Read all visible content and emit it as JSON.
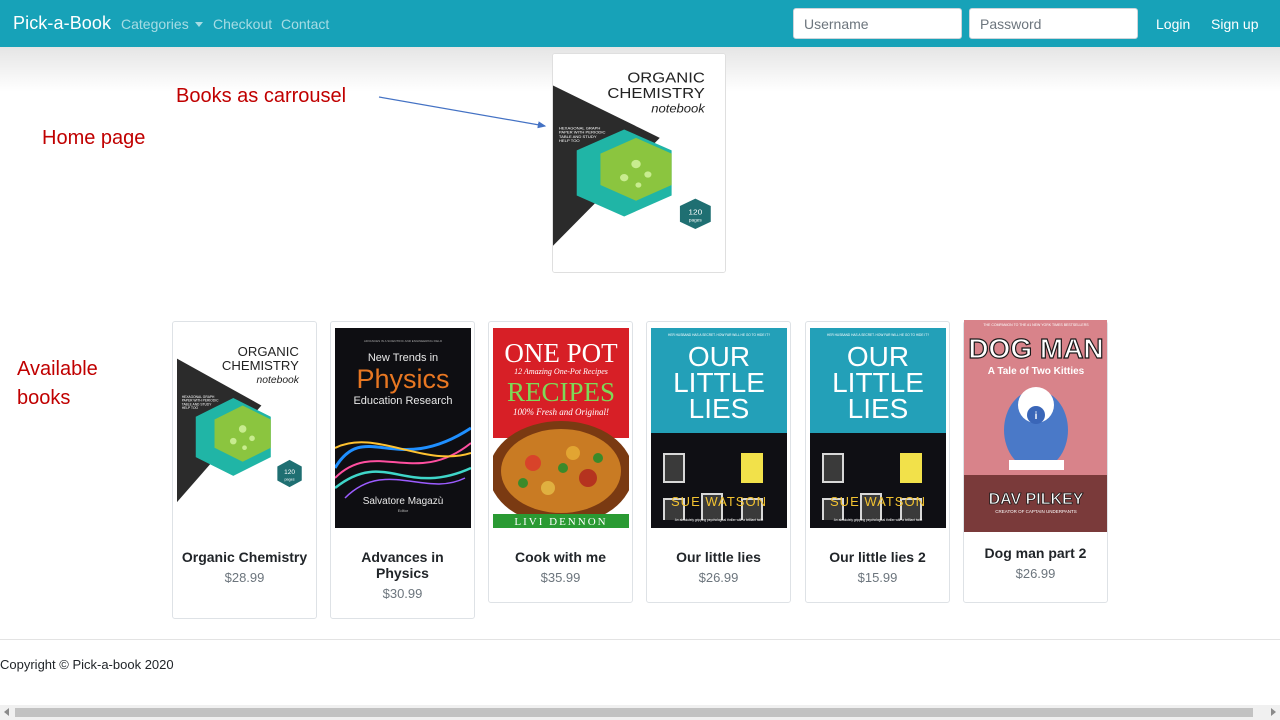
{
  "nav": {
    "brand": "Pick-a-Book",
    "categories": "Categories",
    "checkout": "Checkout",
    "contact": "Contact",
    "username_placeholder": "Username",
    "password_placeholder": "Password",
    "login": "Login",
    "signup": "Sign up"
  },
  "annotations": {
    "carousel": "Books as carrousel",
    "home": "Home page",
    "available_line1": "Available",
    "available_line2": "books"
  },
  "books": [
    {
      "title": "Organic Chemistry",
      "price": "$28.99"
    },
    {
      "title": "Advances in Physics",
      "price": "$30.99"
    },
    {
      "title": "Cook with me",
      "price": "$35.99"
    },
    {
      "title": "Our little lies",
      "price": "$26.99"
    },
    {
      "title": "Our little lies 2",
      "price": "$15.99"
    },
    {
      "title": "Dog man part 2",
      "price": "$26.99"
    }
  ],
  "covers": {
    "organic": {
      "line1": "ORGANIC",
      "line2": "CHEMISTRY",
      "line3": "notebook",
      "small1": "HEXAGONAL GRAPH",
      "small2": "PAPER WITH PERIODIC",
      "small3": "TABLE AND STUDY",
      "small4": "HELP TOO",
      "badge1": "120",
      "badge2": "pages"
    },
    "physics": {
      "top": "ADVANCES IN A SCIENTIFIC AND ENGINEERING FIELD",
      "line1": "New Trends in",
      "line2": "Physics",
      "line3": "Education Research",
      "author": "Salvatore Magazù",
      "role": "Editor"
    },
    "onepot": {
      "line1": "ONE POT",
      "line2": "12 Amazing One-Pot Recipes",
      "line3": "RECIPES",
      "line4": "100% Fresh and Original!",
      "author": "LIVI DENNON"
    },
    "lies": {
      "top": "HER HUSBAND HAS A SECRET. HOW FAR WILL HE GO TO HIDE IT?",
      "line1": "OUR",
      "line2": "LITTLE",
      "line3": "LIES",
      "author": "SUE WATSON",
      "tag": "An absolutely gripping psychological thriller with a brilliant twist"
    },
    "dogman": {
      "top": "THE COMPANION TO THE #1 NEW YORK TIMES BESTSELLERS",
      "line1": "DOG MAN",
      "line2": "A Tale of Two Kitties",
      "author": "DAV PILKEY",
      "sub": "CREATOR OF CAPTAIN UNDERPANTS"
    }
  },
  "footer": {
    "copyright": "Copyright © Pick-a-book 2020"
  },
  "colors": {
    "navbar": "#17a2b8",
    "annotation": "#c00000",
    "arrow": "#4472c4"
  }
}
